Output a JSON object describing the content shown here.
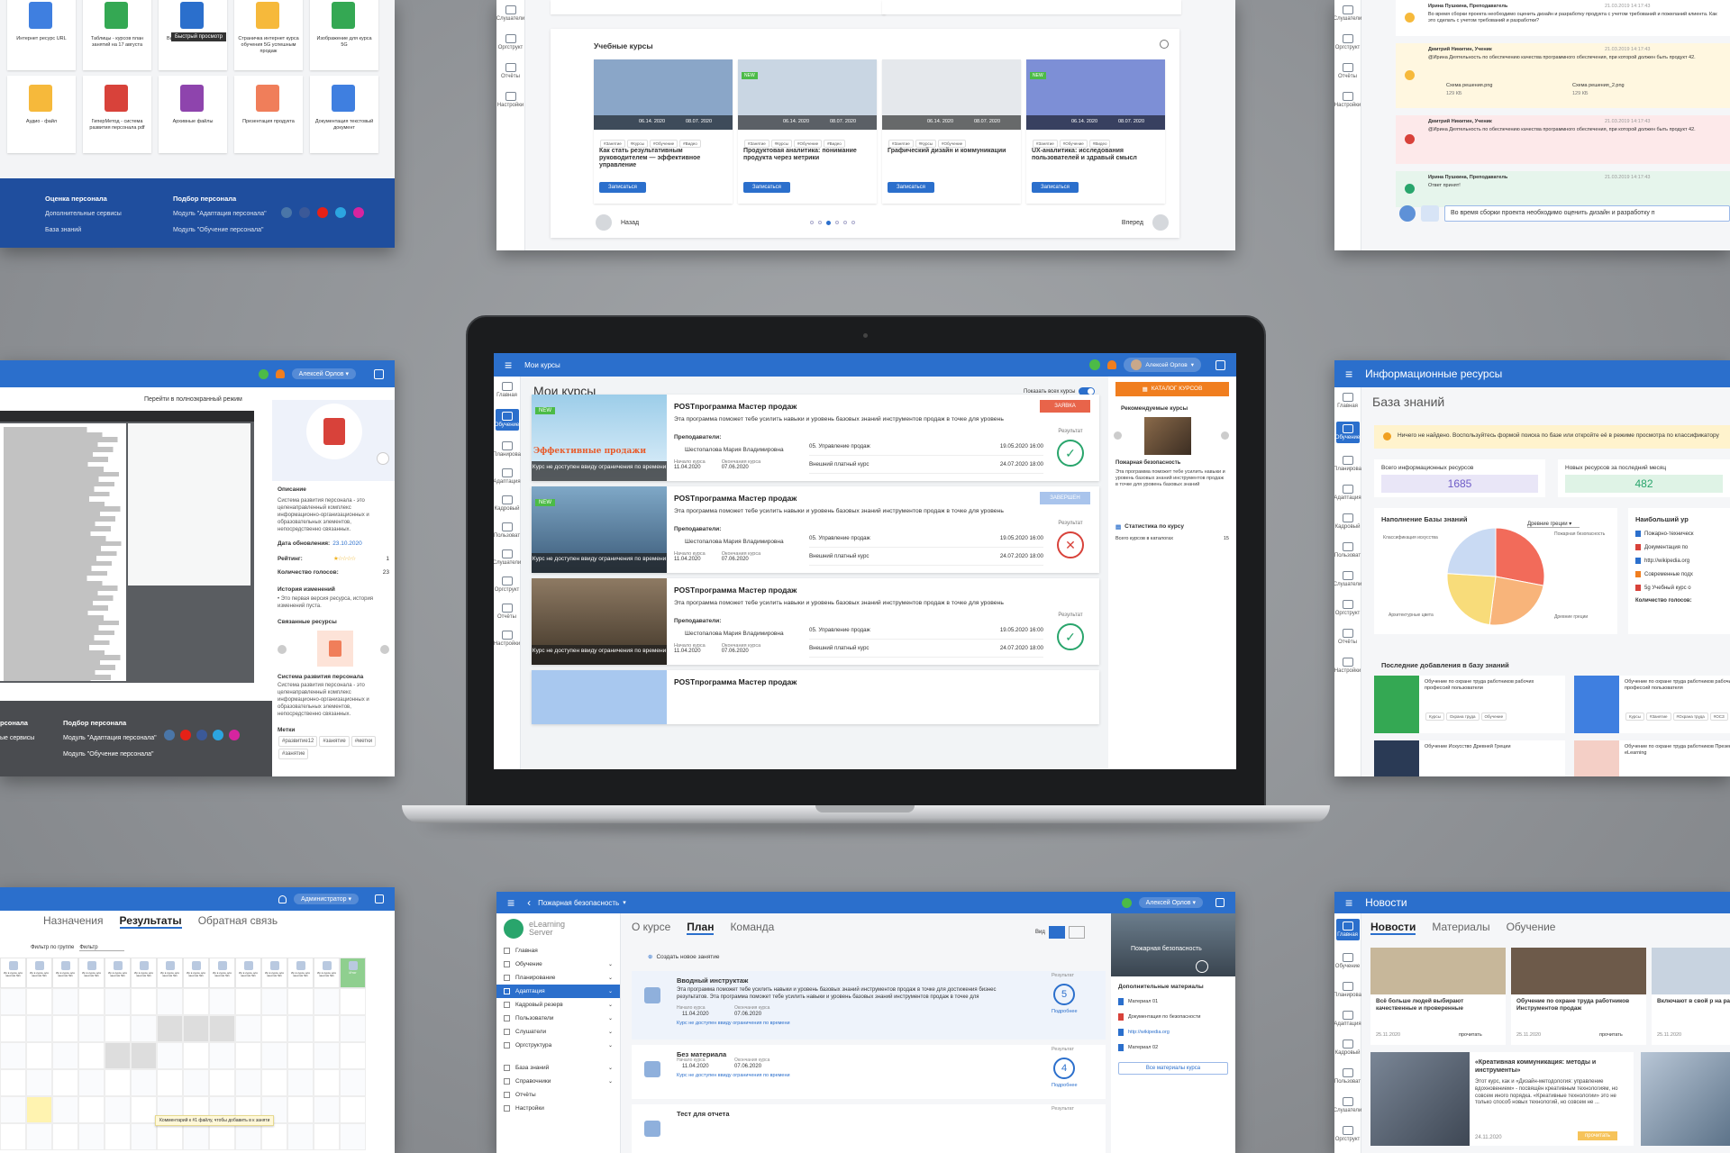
{
  "laptop": {
    "topbar_title": "Мои курсы",
    "user_name": "Алексей Орлов",
    "page_title": "Мои курсы",
    "show_all_label": "Показать всех курсы",
    "catalog_button": "КАТАЛОГ КУРСОВ",
    "rail": [
      "Главная",
      "Обучение",
      "Планирова",
      "Адаптация",
      "Кадровый",
      "Пользоват",
      "Слушатели",
      "Оргструкт",
      "Отчёты",
      "Настройки"
    ],
    "courses": [
      {
        "title": "POSTпрограмма Мастер продаж",
        "desc": "Эта программа поможет тебе усилить навыки и уровень базовых знаний инструментов продаж в точке для уровень",
        "teacher_label": "Преподаватели:",
        "teacher": "Шестопалова Мария Владимировна",
        "start_label": "Начало курса",
        "start": "11.04.2020",
        "end_label": "Окончания курса",
        "end": "07.06.2020",
        "mod1": "05. Управление продаж",
        "mod1_date": "19.05.2020  16:00",
        "mod2": "Внешний платный курс",
        "mod2_date": "24.07.2020  18:00",
        "status": "ЗАЯВКА",
        "status_color": "#e8644a",
        "result_label": "Результат",
        "result": "✓",
        "new": "NEW",
        "banner": "Курс не доступен ввиду ограничения по времени",
        "thumb_text": "Эффективные продажи"
      },
      {
        "title": "POSTпрограмма Мастер продаж",
        "desc": "Эта программа поможет тебе усилить навыки и уровень базовых знаний инструментов продаж в точке для уровень",
        "teacher_label": "Преподаватели:",
        "teacher": "Шестопалова Мария Владимировна",
        "start_label": "Начало курса",
        "start": "11.04.2020",
        "end_label": "Окончания курса",
        "end": "07.06.2020",
        "mod1": "05. Управление продаж",
        "mod1_date": "19.05.2020  16:00",
        "mod2": "Внешний платный курс",
        "mod2_date": "24.07.2020  18:00",
        "status": "ЗАВЕРШЕН",
        "status_color": "#a9c4ec",
        "result_label": "Результат",
        "result": "✕",
        "new": "NEW",
        "banner": "Курс не доступен ввиду ограничения по времени"
      },
      {
        "title": "POSTпрограмма Мастер продаж",
        "desc": "Эта программа поможет тебе усилить навыки и уровень базовых знаний инструментов продаж в точке для уровень",
        "teacher_label": "Преподаватели:",
        "teacher": "Шестопалова Мария Владимировна",
        "start_label": "Начало курса",
        "start": "11.04.2020",
        "end_label": "Окончания курса",
        "end": "07.06.2020",
        "mod1": "05. Управление продаж",
        "mod1_date": "19.05.2020  16:00",
        "mod2": "Внешний платный курс",
        "mod2_date": "24.07.2020  18:00",
        "status": "",
        "status_color": "",
        "result_label": "Результат",
        "result": "✓",
        "banner": "Курс не доступен ввиду ограничения по времени"
      },
      {
        "title": "POSTпрограмма Мастер продаж"
      }
    ],
    "side": {
      "recommended": "Рекомендуемые курсы",
      "rec_title": "Пожарная безопасность",
      "rec_desc": "Эта программа поможет тебе усилить навыки и уровень базовых знаний инструментов продаж в точке для уровень базовых знаний",
      "stats": "Статистика по курсу",
      "total_label": "Всего курсов в каталогах",
      "total": "15"
    }
  },
  "top_left": {
    "files": [
      "Интернет ресурс URL",
      "Таблицы - курсов план занятий на 17 августа",
      "Видео-семинар eClass",
      "Страничка интернет курса обучения 5G успешным продаж",
      "Изображение для курса 5G",
      "Аудио - файл",
      "ГиперМетод - система развития персонала pdf",
      "Архивные файлы",
      "Презентация продукта",
      "Документация текстовый документ"
    ],
    "tooltip": "Быстрый просмотр",
    "footer": {
      "col1_title": "Оценка персонала",
      "col1_a": "Дополнительные сервисы",
      "col1_b": "База знаний",
      "col2_title": "Подбор персонала",
      "col2_a": "Модуль \"Адаптация персонала\"",
      "col2_b": "Модуль \"Обучение персонала\""
    }
  },
  "top_mid": {
    "title": "Учебные курсы",
    "rail": [
      "Слушатели",
      "Оргструкт",
      "Отчёты",
      "Настройки"
    ],
    "cards": [
      {
        "title": "Как стать результативным руководителем — эффективное управление",
        "d1": "06.14. 2020",
        "d2": "08.07. 2020",
        "btn": "Записаться",
        "tags": [
          "#Занятие",
          "#Курсы",
          "#Обучение",
          "#Видео"
        ],
        "new": ""
      },
      {
        "title": "Продуктовая аналитика: понимание продукта через метрики",
        "d1": "06.14. 2020",
        "d2": "08.07. 2020",
        "btn": "Записаться",
        "tags": [
          "#Занятие",
          "#Курсы",
          "#Обучение",
          "#Видео"
        ],
        "new": "NEW"
      },
      {
        "title": "Графический дизайн и коммуникации",
        "d1": "06.14. 2020",
        "d2": "08.07. 2020",
        "btn": "Записаться",
        "tags": [
          "#Занятие",
          "#Курсы",
          "#Обучение"
        ],
        "new": ""
      },
      {
        "title": "UX-аналитика: исследования пользователей и здравый смысл",
        "d1": "06.14. 2020",
        "d2": "08.07. 2020",
        "btn": "Записаться",
        "tags": [
          "#Занятие",
          "#Обучение",
          "#Видео"
        ],
        "new": "NEW"
      }
    ],
    "back": "Назад",
    "forward": "Вперед"
  },
  "top_right": {
    "rail": [
      "Слушатели",
      "Оргструкт",
      "Отчёты",
      "Настройки"
    ],
    "msgs": [
      {
        "author": "Ирина Пушкина, Преподаватель",
        "date": "21.03.2019 14:17:43",
        "text": "Во время сборки проекта необходимо оценить дизайн и разработку продукта с учетом требований и пожеланий клиента. Как это сделать с учетом требований и разработки?"
      },
      {
        "author": "Дмитрий Никитин, Ученик",
        "date": "21.03.2019 14:17:43",
        "text": "@Ирина Деятельность по обеспечению качества программного обеспечения, при которой должен быть продукт 42.",
        "f1": "Схема решения.png",
        "f1s": "129 КБ",
        "f2": "Схема решения_2.png",
        "f2s": "129 КБ"
      },
      {
        "author": "Дмитрий Никитин, Ученик",
        "date": "21.03.2019 14:17:43",
        "text": "@Ирина Деятельность по обеспечению качества программного обеспечения, при которой должен быть продукт 42."
      },
      {
        "author": "Ирина Пушкина, Преподаватель",
        "date": "21.03.2019 14:17:43",
        "text": "Ответ принят!"
      }
    ],
    "input": "Во время сборки проекта необходимо оценить дизайн и разработку п"
  },
  "mid_left": {
    "fullscreen": "Перейти в полноэкранный режим",
    "user": "Алексей Орлов",
    "desc_label": "Описание",
    "desc": "Система развития персонала - это целенаправленный комплекс информационно-организационных и образовательных элементов, непосредственно связанных.",
    "updated_label": "Дата обновления:",
    "updated": "23.10.2020",
    "rating_label": "Рейтинг:",
    "rating": "1",
    "votes_label": "Количество голосов:",
    "votes": "23",
    "history_label": "История изменений",
    "history": "• Это первая версия ресурса, история изменений пуста.",
    "related_label": "Связанные ресурсы",
    "related_title": "Система развития персонала",
    "related_desc": "Система развития персонала - это целенаправленный комплекс информационно-организационных и образовательных элементов, непосредственно связанных.",
    "tags_label": "Метки",
    "tags": [
      "#развитие12",
      "#занятие",
      "#метки",
      "#занятие"
    ],
    "footer": {
      "col1_title": "рсонала",
      "col1_a": "ые сервисы",
      "col2_title": "Подбор персонала",
      "col2_a": "Модуль \"Адаптация персонала\"",
      "col2_b": "Модуль \"Обучение персонала\""
    }
  },
  "mid_right": {
    "topbar": "Информационные ресурсы",
    "title": "База знаний",
    "alert": "Ничего не найдено. Воспользуйтесь формой поиска по базе или откройте её в режиме просмотра по классификатору",
    "total_label": "Всего информационных ресурсов",
    "total": "1685",
    "new_label": "Новых ресурсов за последний месяц",
    "new": "482",
    "fill_label": "Наполнение Базы знаний",
    "dropdown": "Древние греции",
    "most_label": "Наибольший ур",
    "pie_labels": [
      "Классификация искусства",
      "Пожарная безопасность",
      "Древние греции",
      "Архитектурные цвета"
    ],
    "most_items": [
      "Пожарно-техническ",
      "Документация по",
      "http://wikipedia.org",
      "Современные подх",
      "5g Учебный курс о"
    ],
    "votes_label": "Количество голосов:",
    "recent_label": "Последние добавления в базу знаний",
    "recent": [
      {
        "t": "Обучение по охране труда работников рабочих профессий пользователи",
        "tags": [
          "Курсы",
          "Охрана труда",
          "Обучение"
        ]
      },
      {
        "t": "Обучение по охране труда работников рабочих профессий пользователя",
        "tags": [
          "Курсы",
          "#Занятие",
          "#Охрана труда",
          "#ОСЗ"
        ]
      },
      {
        "t": "Обучение Искусство Древней Греции"
      },
      {
        "t": "Обучение по охране труда работников Презентация 5G eLearning"
      }
    ],
    "rail": [
      "Главная",
      "Обучение",
      "Планирова",
      "Адаптация",
      "Кадровый",
      "Пользоват",
      "Слушатели",
      "Оргструкт",
      "Отчёты",
      "Настройки"
    ]
  },
  "bottom_left": {
    "tabs": [
      "Назначения",
      "Результаты",
      "Обратная связь"
    ],
    "user": "Администратор",
    "filter_label": "Фильтр по группе",
    "filter_value": "Фильтр",
    "col_label": "Ир в курсе для занятия №1",
    "final": "Итог",
    "tooltip": "Комментарий к #1 файлу, чтобы добавить в к заняти"
  },
  "bottom_mid": {
    "topbar": "Пожарная безопасность",
    "user": "Алексей Орлов",
    "brand": "eLearning Server",
    "menu": [
      "Главная",
      "Обучение",
      "Планирование",
      "Адаптация",
      "Кадровый резерв",
      "Пользователи",
      "Слушатели",
      "Оргструктура",
      "База знаний",
      "Справочники",
      "Отчёты",
      "Настройки"
    ],
    "tabs": [
      "О курсе",
      "План",
      "Команда"
    ],
    "view": "Вид",
    "create": "Создать новое занятие",
    "items": [
      {
        "t": "Вводный инструктаж",
        "d": "Эта программа поможет тебе усилить навыки и уровень базовых знаний инструментов продаж в точке для достижения бизнес результатов. Эта программа поможет тебе усилить навыки и уровень базовых знаний инструментов продаж в точке для",
        "s": "11.04.2020",
        "e": "07.06.2020",
        "r": "5",
        "note": "Курс не доступен ввиду ограничения по времени"
      },
      {
        "t": "Без материала",
        "s": "11.04.2020",
        "e": "07.06.2020",
        "r": "4",
        "note": "Курс не доступен ввиду ограничения по времени"
      },
      {
        "t": "Тест для отчета"
      }
    ],
    "result": "Результат",
    "details": "Подробнее",
    "start": "Начало курса",
    "end": "Окончания курса",
    "side_title": "Пожарная безопасность",
    "extra": "Дополнительные материалы",
    "mats": [
      "Материал 01",
      "Документация по безопасности",
      "http://wikipedia.org",
      "Материал 02"
    ],
    "all_mats": "Все материалы курса"
  },
  "bottom_right": {
    "topbar": "Новости",
    "tabs": [
      "Новости",
      "Материалы",
      "Обучение"
    ],
    "news": [
      {
        "t": "Всё больше людей выбирают качественные и проверенные",
        "d": "25.11.2020",
        "r": "прочитать"
      },
      {
        "t": "Обучение по охране труда работников Инструментов продаж",
        "d": "25.11.2020",
        "r": "прочитать"
      },
      {
        "t": "Включают в свой р на растительной",
        "d": "25.11.2020",
        "r": ""
      }
    ],
    "feature": {
      "t": "«Креативная коммуникация: методы и инструменты»",
      "d": "Этот курс, как и «Дизайн-методология: управление вдохновением» - посвящён креативным технологиям, но совсем иного порядка. «Креативные технологии» это не только способ новых технологий, но совсем не ...",
      "date": "24.11.2020",
      "r": "прочитать"
    },
    "rail": [
      "Главная",
      "Обучение",
      "Планирова",
      "Адаптация",
      "Кадровый",
      "Пользоват",
      "Слушатели",
      "Оргструкт"
    ]
  },
  "colors": {
    "brand": "#2b6fcc",
    "accent_orange": "#f07e1f",
    "green": "#29a56c",
    "red": "#d8423a"
  }
}
